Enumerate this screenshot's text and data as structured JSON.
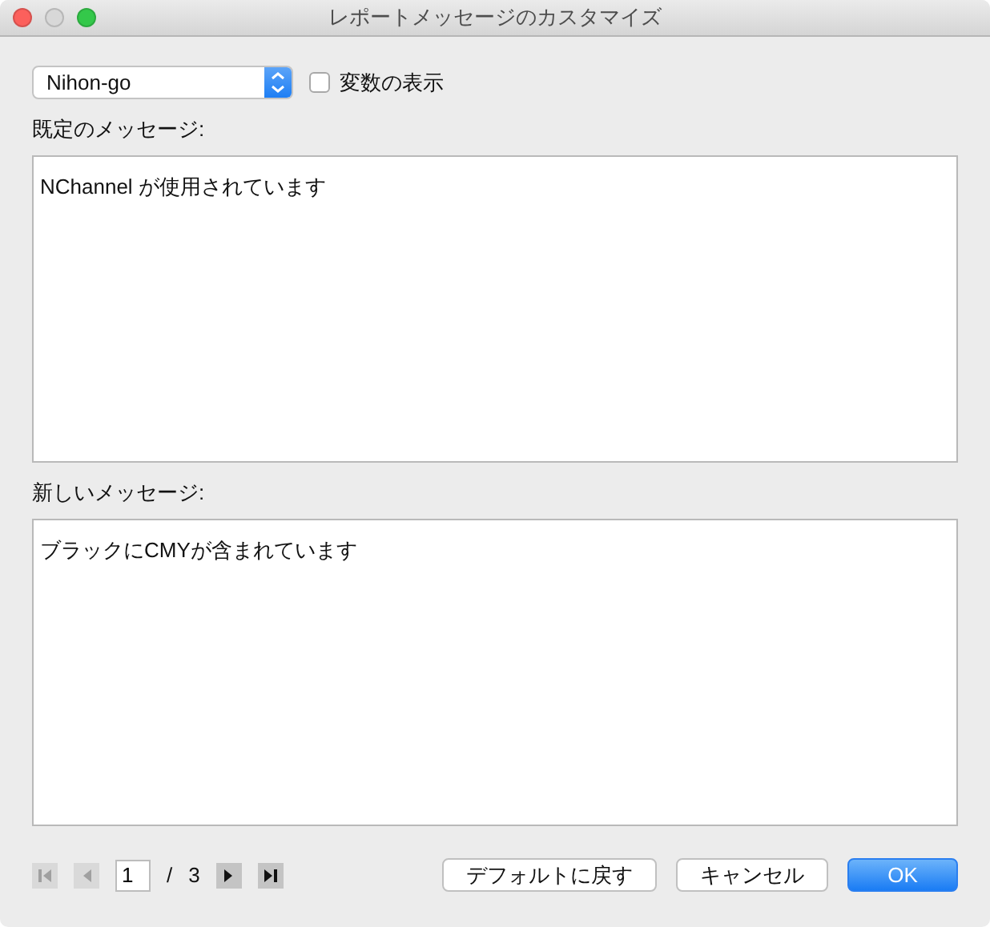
{
  "window": {
    "title": "レポートメッセージのカスタマイズ"
  },
  "language_select": {
    "value": "Nihon-go"
  },
  "show_variables": {
    "label": "変数の表示",
    "checked": false
  },
  "default_message": {
    "label": "既定のメッセージ:",
    "value": "NChannel が使用されています"
  },
  "new_message": {
    "label": "新しいメッセージ:",
    "value": "ブラックにCMYが含まれています"
  },
  "pager": {
    "nav": [
      {
        "kind": "first",
        "disabled": true
      },
      {
        "kind": "prev",
        "disabled": true
      }
    ],
    "page": "1",
    "separator": "/",
    "total": "3",
    "nav_after": [
      {
        "kind": "next",
        "disabled": false
      },
      {
        "kind": "last",
        "disabled": false
      }
    ]
  },
  "buttons": [
    {
      "label": "デフォルトに戻す",
      "kind": "normal"
    },
    {
      "label": "キャンセル",
      "kind": "normal"
    },
    {
      "label": "OK",
      "kind": "default"
    }
  ]
}
